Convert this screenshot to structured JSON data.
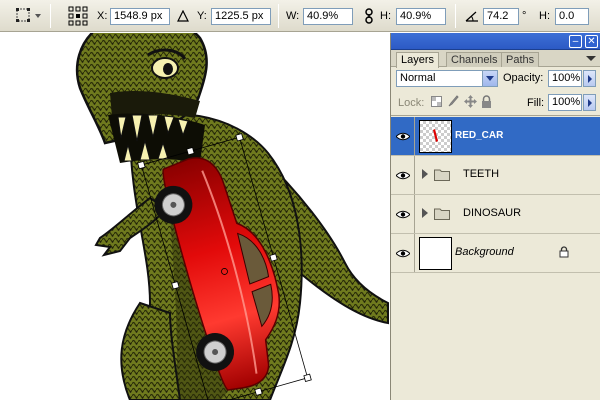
{
  "options_bar": {
    "tool_icon": "move-transform-icon",
    "reference_point_icon": "reference-point-grid-icon",
    "x_label": "X:",
    "x_value": "1548.9 px",
    "delta_icon": "delta-relative-icon",
    "y_label": "Y:",
    "y_value": "1225.5 px",
    "w_label": "W:",
    "w_value": "40.9%",
    "link_icon": "link-chain-icon",
    "h_label": "H:",
    "h_value": "40.9%",
    "angle_icon": "rotate-angle-icon",
    "angle_value": "74.2",
    "degree_symbol": "°",
    "skew_h_label": "H:",
    "skew_h_value": "0.0"
  },
  "layers_panel": {
    "tabs": [
      {
        "label": "Layers"
      },
      {
        "label": "Channels"
      },
      {
        "label": "Paths"
      }
    ],
    "active_tab": "Layers",
    "blend_mode": "Normal",
    "opacity_label": "Opacity:",
    "opacity_value": "100%",
    "lock_label": "Lock:",
    "fill_label": "Fill:",
    "fill_value": "100%",
    "layers": [
      {
        "name": "RED_CAR",
        "type": "layer",
        "visible": true,
        "selected": true
      },
      {
        "name": "TEETH",
        "type": "group",
        "visible": true,
        "selected": false
      },
      {
        "name": "DINOSAUR",
        "type": "group",
        "visible": true,
        "selected": false
      },
      {
        "name": "Background",
        "type": "background",
        "visible": true,
        "locked": true,
        "selected": false
      }
    ]
  },
  "colors": {
    "selection_blue": "#316ac5",
    "panel_bg": "#ece9d8",
    "car_red": "#e00000",
    "dino_green": "#6f7a1e",
    "dino_dark": "#1a1a0a",
    "teeth_cream": "#f6f1b0"
  }
}
